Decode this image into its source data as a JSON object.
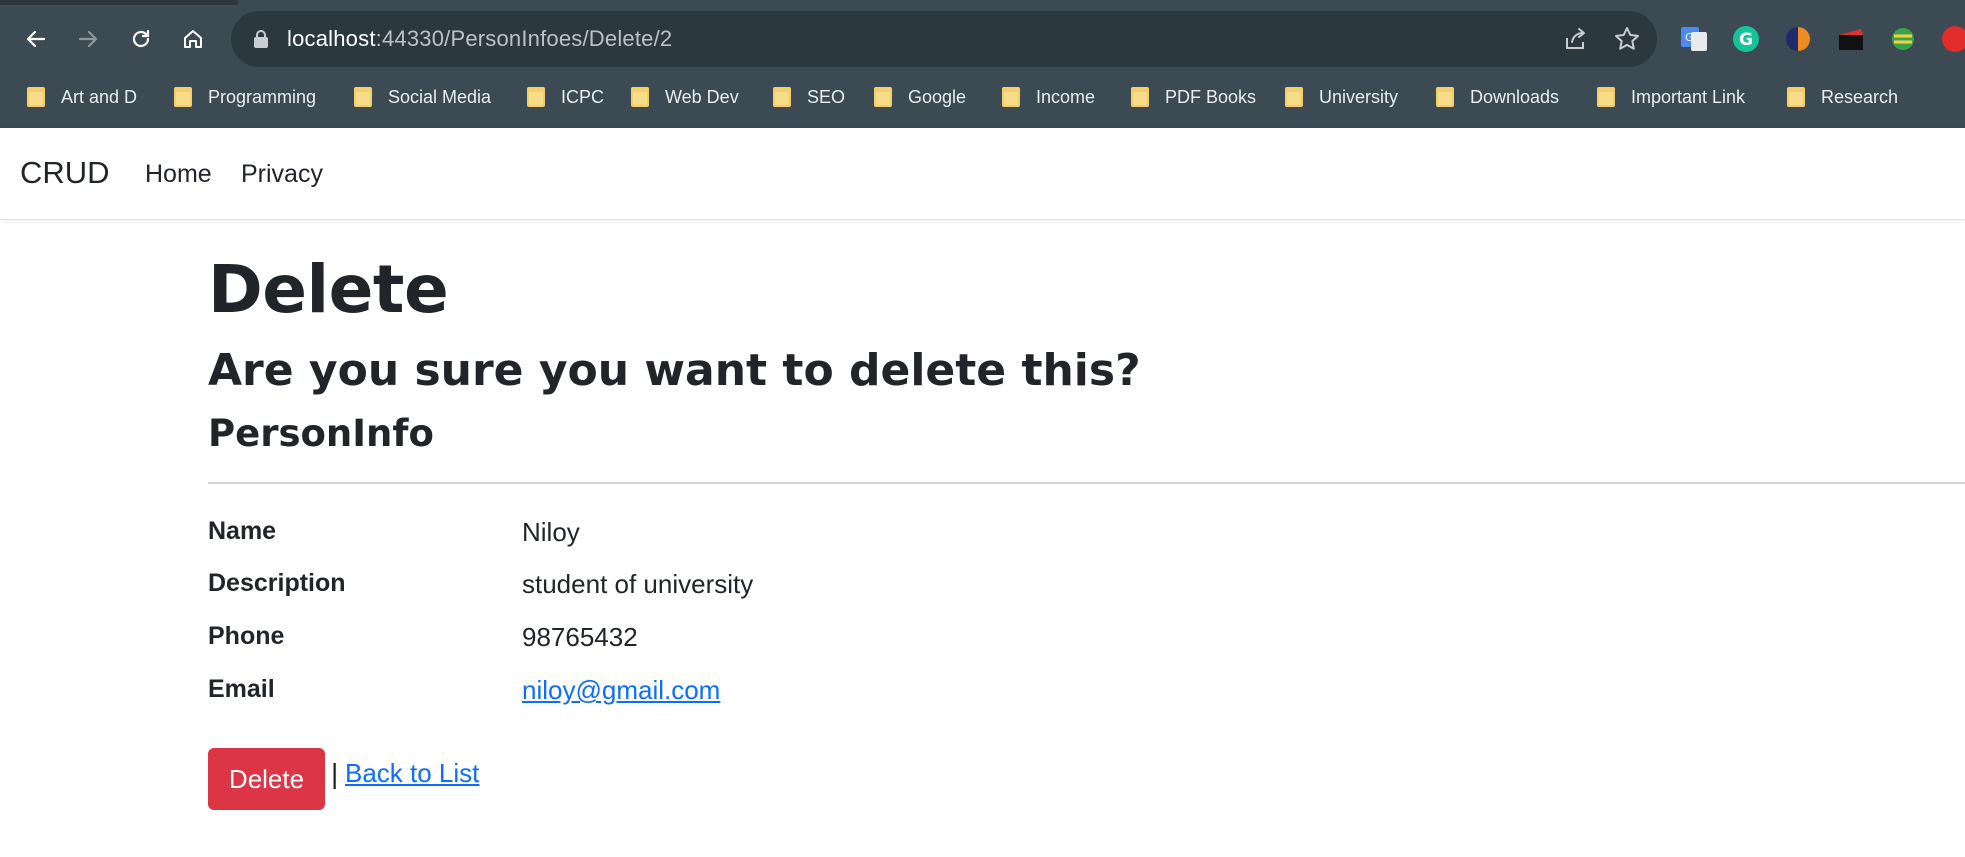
{
  "browser": {
    "url_host": "localhost",
    "url_path": ":44330/PersonInfoes/Delete/2",
    "bookmarks": [
      "Art and D",
      "Programming",
      "Social Media",
      "ICPC",
      "Web Dev",
      "SEO",
      "Google",
      "Income",
      "PDF Books",
      "University",
      "Downloads",
      "Important Link",
      "Research"
    ]
  },
  "navbar": {
    "brand": "CRUD",
    "links": [
      "Home",
      "Privacy"
    ]
  },
  "page": {
    "title": "Delete",
    "confirm_text": "Are you sure you want to delete this?",
    "entity_name": "PersonInfo",
    "fields": [
      {
        "label": "Name",
        "value": "Niloy"
      },
      {
        "label": "Description",
        "value": "student of university"
      },
      {
        "label": "Phone",
        "value": "98765432"
      },
      {
        "label": "Email",
        "value": "niloy@gmail.com"
      }
    ],
    "delete_label": "Delete",
    "separator": "|",
    "back_label": "Back to List"
  },
  "colors": {
    "chrome_bg": "#3c4a54",
    "danger": "#dc3545",
    "link": "#0d6efd"
  }
}
